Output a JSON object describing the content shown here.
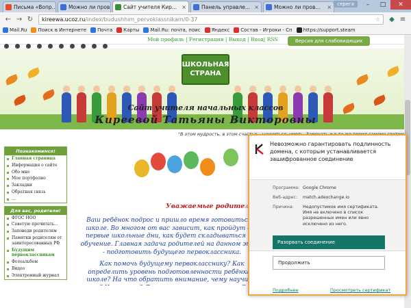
{
  "browser": {
    "tabs": [
      {
        "label": "Письма «Вопр...",
        "icon_color": "#e64b2b",
        "active": false
      },
      {
        "label": "Можно ли пров...",
        "icon_color": "#3d6fd6",
        "active": false
      },
      {
        "label": "Сайт учителя Кир...",
        "icon_color": "#3a8f3a",
        "active": true
      },
      {
        "label": "Панель управле...",
        "icon_color": "#3d6fd6",
        "active": false
      },
      {
        "label": "Можно ли пров...",
        "icon_color": "#3d6fd6",
        "active": false
      }
    ],
    "profile_label": "серега",
    "url_host": "kireewa.ucoz.ru",
    "url_path": "/index/budushhim_pervoklassnikam/0-37",
    "bookmarks": [
      {
        "label": "Mail.Ru",
        "icon_color": "#2b77d9"
      },
      {
        "label": "Поиск в Интернете",
        "icon_color": "#f08c1a"
      },
      {
        "label": "Почта",
        "icon_color": "#2b77d9"
      },
      {
        "label": "Карты",
        "icon_color": "#d9302b"
      },
      {
        "label": "Mail.Ru: почта, поис",
        "icon_color": "#2b77d9"
      },
      {
        "label": "Яндекс",
        "icon_color": "#d9302b"
      },
      {
        "label": "Состав - Игроки - Сп",
        "icon_color": "#d9302b"
      },
      {
        "label": "https://support.steam",
        "icon_color": "#222222"
      }
    ]
  },
  "site": {
    "top_links": "Мой профиль | Регистрация | Выход | Вход| RSS",
    "visually_impaired": "Версия для слабовидящих",
    "sign_line1": "ШКОЛЬНАЯ",
    "sign_line2": "СТРАНА",
    "title_line1": "Сайт учителя начальных классов",
    "title_line2": "Киреевой Татьяны Викторовны",
    "motto": "\"В этом мудрость, в этом счастье – научиться, уметь, Замечать и в то же время самому светом светить\"",
    "sidebar": [
      {
        "heading": "Познакомимся!",
        "items": [
          {
            "label": "Главная страница",
            "active": true
          },
          {
            "label": "Информация о сайте",
            "active": false
          },
          {
            "label": "Обо мне",
            "active": false
          },
          {
            "label": "Мое портфолио",
            "active": false
          },
          {
            "label": "Закладки",
            "active": false
          },
          {
            "label": "Обратная связь",
            "active": false
          },
          {
            "label": "...",
            "active": false
          }
        ]
      },
      {
        "heading": "Для вас, родители!",
        "items": [
          {
            "label": "ФГОС НОО",
            "active": false
          },
          {
            "label": "Советую прочитать...",
            "active": false
          },
          {
            "label": "Заповеди родителям",
            "active": false
          },
          {
            "label": "Памятки родителям от заинтересованных РФ",
            "active": false
          },
          {
            "label": "Будущим первоклассникам",
            "active": true
          },
          {
            "label": "Фотоальбом",
            "active": false
          },
          {
            "label": "Видео",
            "active": false
          },
          {
            "label": "Электронный журнал",
            "active": false
          }
        ]
      }
    ],
    "dear_parents": "Уважаемые родители!",
    "paragraph1": "Ваш ребёнок подрос и пришло время готовиться к школе. Во многом от вас зависит, как пройдут его первые школьные дни, как будет складываться его обучение. Главная задача родителей на данном этапе - подготовить будущего первоклассника.",
    "paragraph2": "Как помочь будущему первокласснику? Как определить уровень подготовленности ребёнка к школе? На что обратить внимание, чему научить его? Что с ним? Данные странички помогут Вам ответить на эти вопросы."
  },
  "kaspersky": {
    "title": "Невозможно гарантировать подлинность домена, с которым устанавливается зашифрованное соединение",
    "program_label": "Программа:",
    "program_value": "Google Chrome",
    "web_label": "Веб-адрес:",
    "web_value": "match.adexchange.io",
    "reason_label": "Причина:",
    "reason_value": "Недопустимое имя сертификата. Имя не включено в список разрешенных имен или явно исключено из него.",
    "button_block": "Разорвать соединение",
    "button_continue": "Продолжить",
    "link_details": "Подробнее",
    "link_cert": "Просмотреть сертификат",
    "accent_color": "#157567",
    "border_color": "#f2a641"
  }
}
